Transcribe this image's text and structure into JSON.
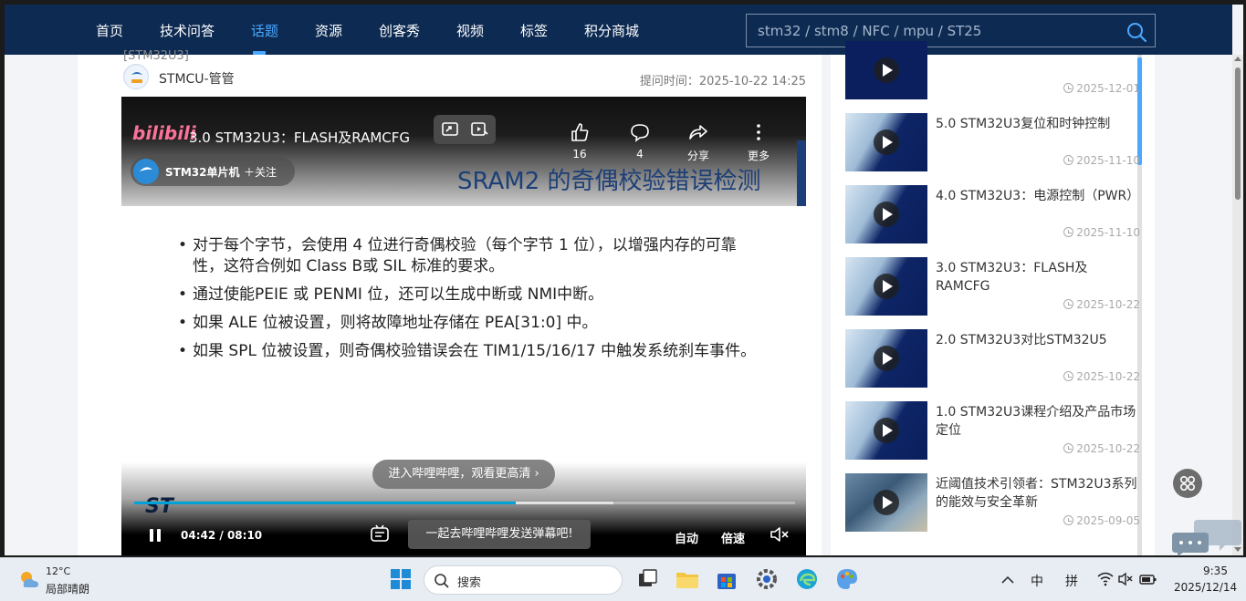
{
  "nav": {
    "items": [
      "首页",
      "技术问答",
      "话题",
      "资源",
      "创客秀",
      "视频",
      "标签",
      "积分商城"
    ],
    "active_index": 2,
    "search_placeholder": "stm32 / stm8 / NFC / mpu / ST25"
  },
  "post": {
    "clipped_header": "[STM32U3]",
    "author_name": "STMCU-管管",
    "time_label": "提问时间：2025-10-22 14:25"
  },
  "video": {
    "platform_logo": "bilibili",
    "title": "3.0 STM32U3：FLASH及RAMCFG",
    "likes": "16",
    "comments": "4",
    "share_label": "分享",
    "more_label": "更多",
    "channel_name": "STM32单片机",
    "follow_label": "＋关注",
    "slide_title": "SRAM2 的奇偶校验错误检测",
    "bullets": [
      "对于每个字节，会使用 4 位进行奇偶校验（每个字节 1 位），以增强内存的可靠性，这符合例如 Class B或 SIL 标准的要求。",
      "通过使能PEIE 或 PENMI 位，还可以生成中断或 NMI中断。",
      "如果 ALE 位被设置，则将故障地址存储在 PEA[31:0] 中。",
      "如果 SPL 位被设置，则奇偶校验错误会在 TIM1/15/16/17 中触发系统刹车事件。"
    ],
    "enter_bili_label": "进入哔哩哔哩，观看更高清 ›",
    "brand_logo": "ST",
    "current_time": "04:42",
    "duration": "08:10",
    "progress_fraction": 0.577,
    "buffer_fraction": 0.725,
    "danmaku_placeholder": "一起去哔哩哔哩发送弹幕吧!",
    "auto_label": "自动",
    "speed_label": "倍速"
  },
  "sidebar": {
    "items": [
      {
        "title": "",
        "date": "2025-12-01"
      },
      {
        "title": "5.0 STM32U3复位和时钟控制",
        "date": "2025-11-10"
      },
      {
        "title": "4.0 STM32U3：电源控制（PWR）",
        "date": "2025-11-10"
      },
      {
        "title": "3.0 STM32U3：FLASH及RAMCFG",
        "date": "2025-10-22"
      },
      {
        "title": "2.0 STM32U3对比STM32U5",
        "date": "2025-10-22"
      },
      {
        "title": "1.0 STM32U3课程介绍及产品市场定位",
        "date": "2025-10-22"
      },
      {
        "title": "近阈值技术引领者：STM32U3系列的能效与安全革新",
        "date": "2025-09-05"
      }
    ]
  },
  "taskbar": {
    "weather_temp": "12°C",
    "weather_desc": "局部晴朗",
    "search_label": "搜索",
    "ime_lang": "中",
    "ime_mode": "拼",
    "time": "9:35",
    "date": "2025/12/14"
  },
  "colors": {
    "nav_bg": "#0d2a52",
    "accent": "#4aa8ff",
    "progress": "#00a1d6",
    "bili_pink": "#fb7299"
  }
}
